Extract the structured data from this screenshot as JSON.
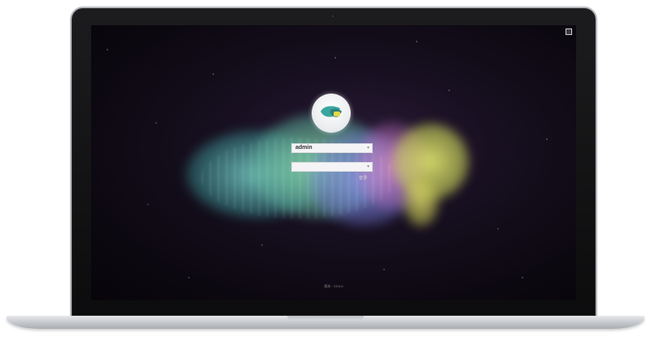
{
  "login": {
    "username_value": "admin",
    "password_value": "",
    "submit_label": "登录",
    "dropdown_icon": "chevron-down-icon"
  },
  "footer": {
    "text": "版本 · V3.0.0"
  },
  "colors": {
    "bezel": "#0c0c0d",
    "screen_bg": "#160f1f",
    "field_bg": "#f4f4f6",
    "cloud_teal": "#78d2c8",
    "cloud_yellow": "#e6eb6e"
  }
}
